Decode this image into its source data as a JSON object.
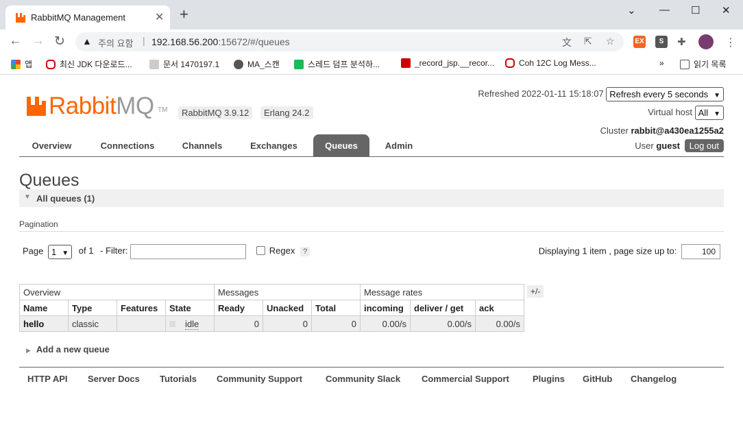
{
  "browser": {
    "tab_title": "RabbitMQ Management",
    "security_label": "주의 요함",
    "url_host": "192.168.56.200",
    "url_rest": ":15672/#/queues",
    "bookmarks": [
      {
        "label": "앱",
        "color": "#ea4335"
      },
      {
        "label": "최신 JDK 다운로드...",
        "color": "#c00"
      },
      {
        "label": "문서 1470197.1",
        "color": "#999"
      },
      {
        "label": "MA_스캔",
        "color": "#555"
      },
      {
        "label": "스레드 덤프 분석하...",
        "color": "#1db954"
      },
      {
        "label": "_record_jsp.__recor...",
        "color": "#c00"
      },
      {
        "label": "Coh 12C Log Mess...",
        "color": "#c00"
      }
    ],
    "reading_list": "읽기 목록"
  },
  "header": {
    "logo_rabbit": "Rabbit",
    "logo_mq": "MQ",
    "logo_tm": "TM",
    "rabbitmq_version": "RabbitMQ 3.9.12",
    "erlang_version": "Erlang 24.2",
    "refreshed_label": "Refreshed 2022-01-11 15:18:07",
    "refresh_option": "Refresh every 5 seconds",
    "vhost_label": "Virtual host",
    "vhost_value": "All",
    "cluster_label": "Cluster",
    "cluster_value": "rabbit@a430ea1255a2",
    "user_label": "User",
    "user_value": "guest",
    "logout": "Log out"
  },
  "nav": {
    "tabs": [
      "Overview",
      "Connections",
      "Channels",
      "Exchanges",
      "Queues",
      "Admin"
    ],
    "active": "Queues"
  },
  "main": {
    "title": "Queues",
    "section": "All queues (1)",
    "pagination_title": "Pagination",
    "page_label": "Page",
    "page_value": "1",
    "of_label": "of 1",
    "filter_label": "- Filter:",
    "regex_label": "Regex",
    "help": "?",
    "displaying": "Displaying 1 item , page size up to:",
    "page_size": "100"
  },
  "table": {
    "groups": [
      "Overview",
      "Messages",
      "Message rates"
    ],
    "plus_minus": "+/-",
    "columns": [
      "Name",
      "Type",
      "Features",
      "State",
      "Ready",
      "Unacked",
      "Total",
      "incoming",
      "deliver / get",
      "ack"
    ],
    "rows": [
      {
        "name": "hello",
        "type": "classic",
        "features": "",
        "state": "idle",
        "ready": "0",
        "unacked": "0",
        "total": "0",
        "incoming": "0.00/s",
        "deliver_get": "0.00/s",
        "ack": "0.00/s"
      }
    ]
  },
  "add_queue": "Add a new queue",
  "footer": [
    "HTTP API",
    "Server Docs",
    "Tutorials",
    "Community Support",
    "Community Slack",
    "Commercial Support",
    "Plugins",
    "GitHub",
    "Changelog"
  ],
  "colors": {
    "brand": "#ff6600",
    "tab_active": "#666666"
  }
}
